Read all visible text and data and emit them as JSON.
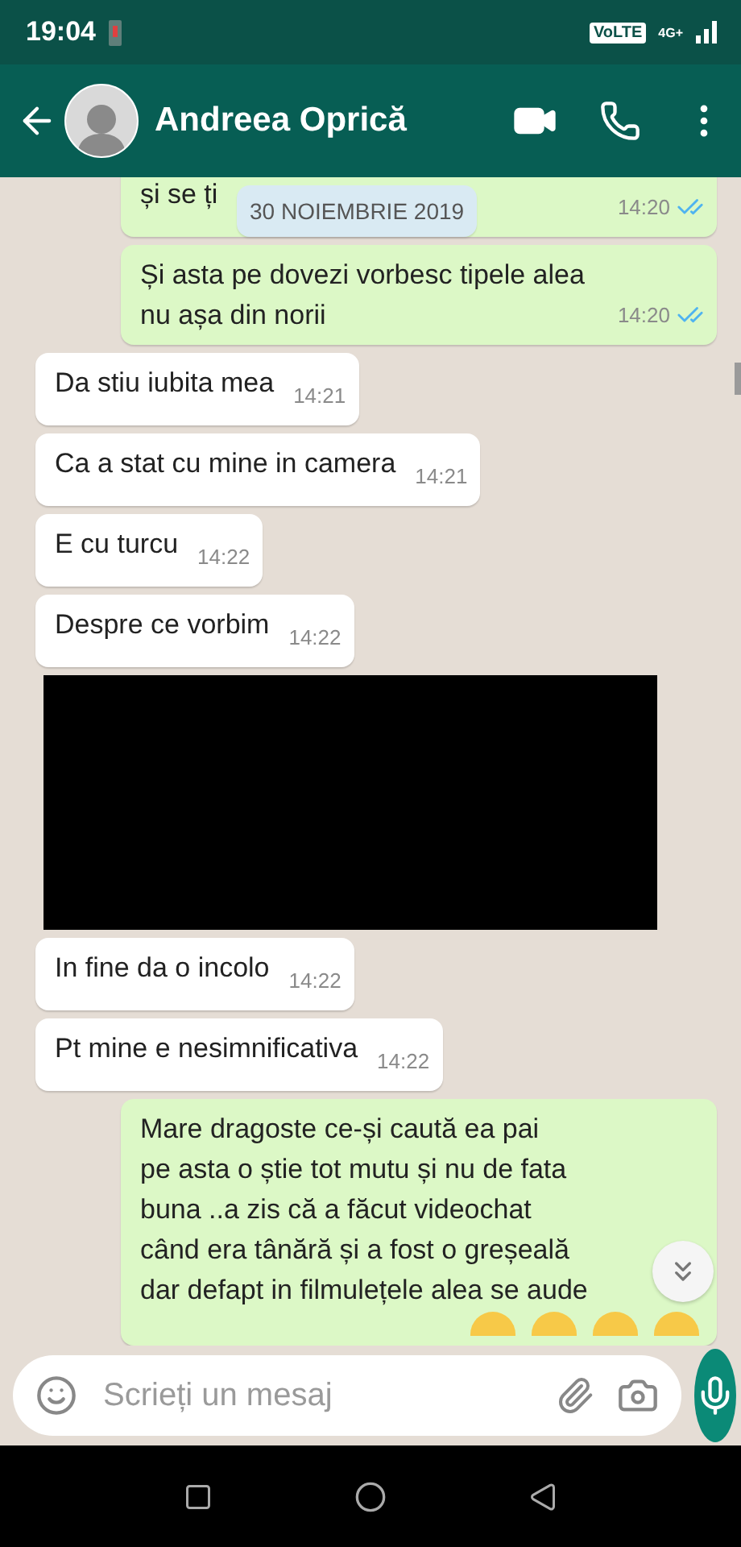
{
  "status_bar": {
    "time": "19:04",
    "volte": "VoLTE",
    "network": "4G+",
    "battery_low": true
  },
  "header": {
    "contact": "Andreea Oprică"
  },
  "date_chip": "30 NOIEMBRIE 2019",
  "messages": [
    {
      "kind": "outgoing",
      "text": "și se ți",
      "time": "14:20",
      "read": true
    },
    {
      "kind": "outgoing",
      "text": "Și asta pe dovezi vorbesc tipele alea\nnu așa din norii",
      "time": "14:20",
      "read": true
    },
    {
      "kind": "incoming",
      "text": "Da stiu iubita mea",
      "time": "14:21"
    },
    {
      "kind": "incoming",
      "text": "Ca a stat cu mine in camera",
      "time": "14:21"
    },
    {
      "kind": "incoming",
      "text": "E cu turcu",
      "time": "14:22"
    },
    {
      "kind": "incoming",
      "text": "Despre ce vorbim",
      "time": "14:22"
    },
    {
      "kind": "redacted"
    },
    {
      "kind": "incoming",
      "text": "In fine da o incolo",
      "time": "14:22"
    },
    {
      "kind": "incoming",
      "text": "Pt mine e nesimnificativa",
      "time": "14:22"
    },
    {
      "kind": "outgoing",
      "text": "Mare dragoste ce-și caută ea pai\npe asta o știe tot mutu și nu de fata\nbuna ..a zis că a făcut videochat\ncând era tânără și a fost o greșeală\ndar defapt in filmulețele alea se aude",
      "emoji_row": true
    }
  ],
  "input": {
    "placeholder": "Scrieți un mesaj"
  }
}
